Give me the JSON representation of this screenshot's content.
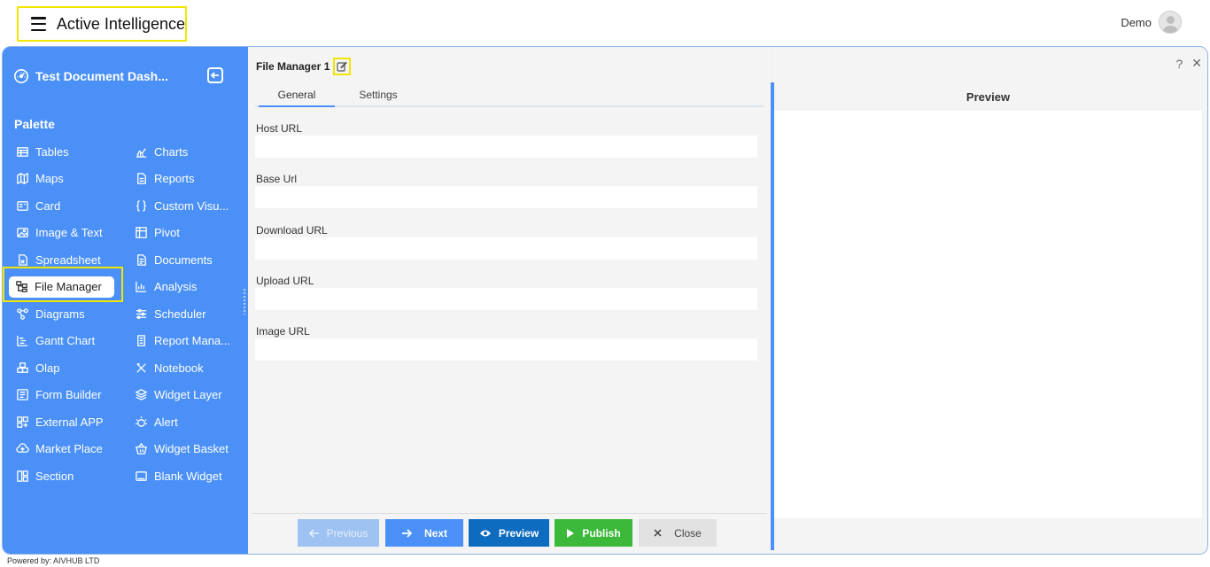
{
  "header": {
    "app_name": "Active Intelligence",
    "user_name": "Demo"
  },
  "sidebar": {
    "dashboard_title": "Test Document Dash...",
    "palette_label": "Palette",
    "left_items": [
      {
        "label": "Tables",
        "icon": "table-icon"
      },
      {
        "label": "Maps",
        "icon": "map-icon"
      },
      {
        "label": "Card",
        "icon": "card-icon"
      },
      {
        "label": "Image & Text",
        "icon": "image-icon"
      },
      {
        "label": "Spreadsheet",
        "icon": "spreadsheet-icon"
      },
      {
        "label": "File Manager",
        "icon": "file-manager-icon"
      },
      {
        "label": "Diagrams",
        "icon": "diagram-icon"
      },
      {
        "label": "Gantt Chart",
        "icon": "gantt-icon"
      },
      {
        "label": "Olap",
        "icon": "olap-icon"
      },
      {
        "label": "Form Builder",
        "icon": "form-icon"
      },
      {
        "label": "External APP",
        "icon": "apps-icon"
      },
      {
        "label": "Market Place",
        "icon": "cloud-icon"
      },
      {
        "label": "Section",
        "icon": "section-icon"
      }
    ],
    "right_items": [
      {
        "label": "Charts",
        "icon": "chart-icon"
      },
      {
        "label": "Reports",
        "icon": "report-icon"
      },
      {
        "label": "Custom Visu...",
        "icon": "braces-icon"
      },
      {
        "label": "Pivot",
        "icon": "pivot-icon"
      },
      {
        "label": "Documents",
        "icon": "document-icon"
      },
      {
        "label": "Analysis",
        "icon": "analysis-icon"
      },
      {
        "label": "Scheduler",
        "icon": "scheduler-icon"
      },
      {
        "label": "Report Mana...",
        "icon": "report-manager-icon"
      },
      {
        "label": "Notebook",
        "icon": "notebook-icon"
      },
      {
        "label": "Widget Layer",
        "icon": "layers-icon"
      },
      {
        "label": "Alert",
        "icon": "alert-icon"
      },
      {
        "label": "Widget Basket",
        "icon": "basket-icon"
      },
      {
        "label": "Blank Widget",
        "icon": "blank-widget-icon"
      }
    ]
  },
  "editor": {
    "title": "File Manager 1",
    "tabs": [
      {
        "label": "General"
      },
      {
        "label": "Settings"
      }
    ],
    "fields": [
      {
        "label": "Host URL",
        "value": ""
      },
      {
        "label": "Base Url",
        "value": ""
      },
      {
        "label": "Download URL",
        "value": ""
      },
      {
        "label": "Upload URL",
        "value": ""
      },
      {
        "label": "Image URL",
        "value": ""
      }
    ],
    "buttons": {
      "previous": "Previous",
      "next": "Next",
      "preview": "Preview",
      "publish": "Publish",
      "close": "Close"
    }
  },
  "preview": {
    "title": "Preview"
  },
  "top_icons": {
    "help": "?",
    "close": "✕"
  },
  "footer": {
    "powered_by": "Powered by: AIVHUB LTD"
  }
}
